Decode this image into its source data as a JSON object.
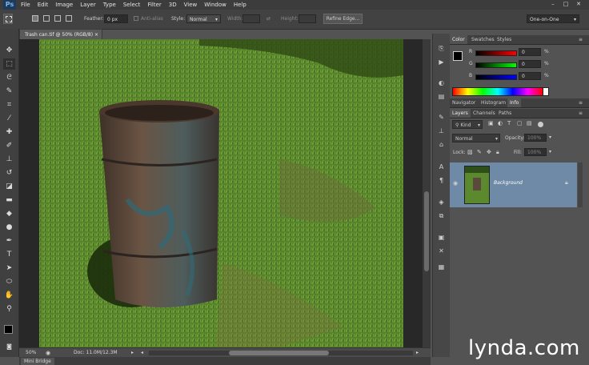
{
  "app": {
    "logo": "Ps"
  },
  "menu": [
    "File",
    "Edit",
    "Image",
    "Layer",
    "Type",
    "Select",
    "Filter",
    "3D",
    "View",
    "Window",
    "Help"
  ],
  "window_controls": [
    "–",
    "□",
    "✕"
  ],
  "options_bar": {
    "feather_label": "Feather:",
    "feather_value": "0 px",
    "antialias_label": "Anti-alias",
    "style_label": "Style:",
    "style_value": "Normal",
    "width_label": "Width:",
    "height_label": "Height:",
    "refine_edge": "Refine Edge...",
    "workspace": "One-on-One"
  },
  "document": {
    "tab_title": "Trash can.tif @ 50% (RGB/8)",
    "zoom": "50%",
    "doc_info": "Doc: 11.0M/12.3M"
  },
  "mini_bridge": "Mini Bridge",
  "color_panel": {
    "tabs": [
      "Color",
      "Swatches",
      "Styles"
    ],
    "channels": [
      {
        "label": "R",
        "value": "0"
      },
      {
        "label": "G",
        "value": "0"
      },
      {
        "label": "B",
        "value": "0"
      }
    ]
  },
  "nav_panel": {
    "tabs": [
      "Navigator",
      "Histogram",
      "Info"
    ]
  },
  "layers_panel": {
    "tabs": [
      "Layers",
      "Channels",
      "Paths"
    ],
    "kind_filter": "Kind",
    "blend_mode": "Normal",
    "opacity_label": "Opacity:",
    "opacity_value": "100%",
    "lock_label": "Lock:",
    "fill_label": "Fill:",
    "fill_value": "100%",
    "layer_name": "Background"
  },
  "watermark": "lynda.com",
  "colors": {
    "ui_dark": "#535353",
    "layer_selected": "#6e8aa6",
    "grass": "#4f7a22",
    "barrel": "#5b4a3c"
  },
  "icons": {
    "tools": [
      "move-icon",
      "marquee-icon",
      "lasso-icon",
      "quick-select-icon",
      "crop-icon",
      "eyedropper-icon",
      "healing-icon",
      "brush-icon",
      "stamp-icon",
      "history-brush-icon",
      "eraser-icon",
      "gradient-icon",
      "blur-icon",
      "dodge-icon",
      "pen-icon",
      "type-icon",
      "path-select-icon",
      "shape-icon",
      "hand-icon",
      "zoom-icon"
    ]
  }
}
